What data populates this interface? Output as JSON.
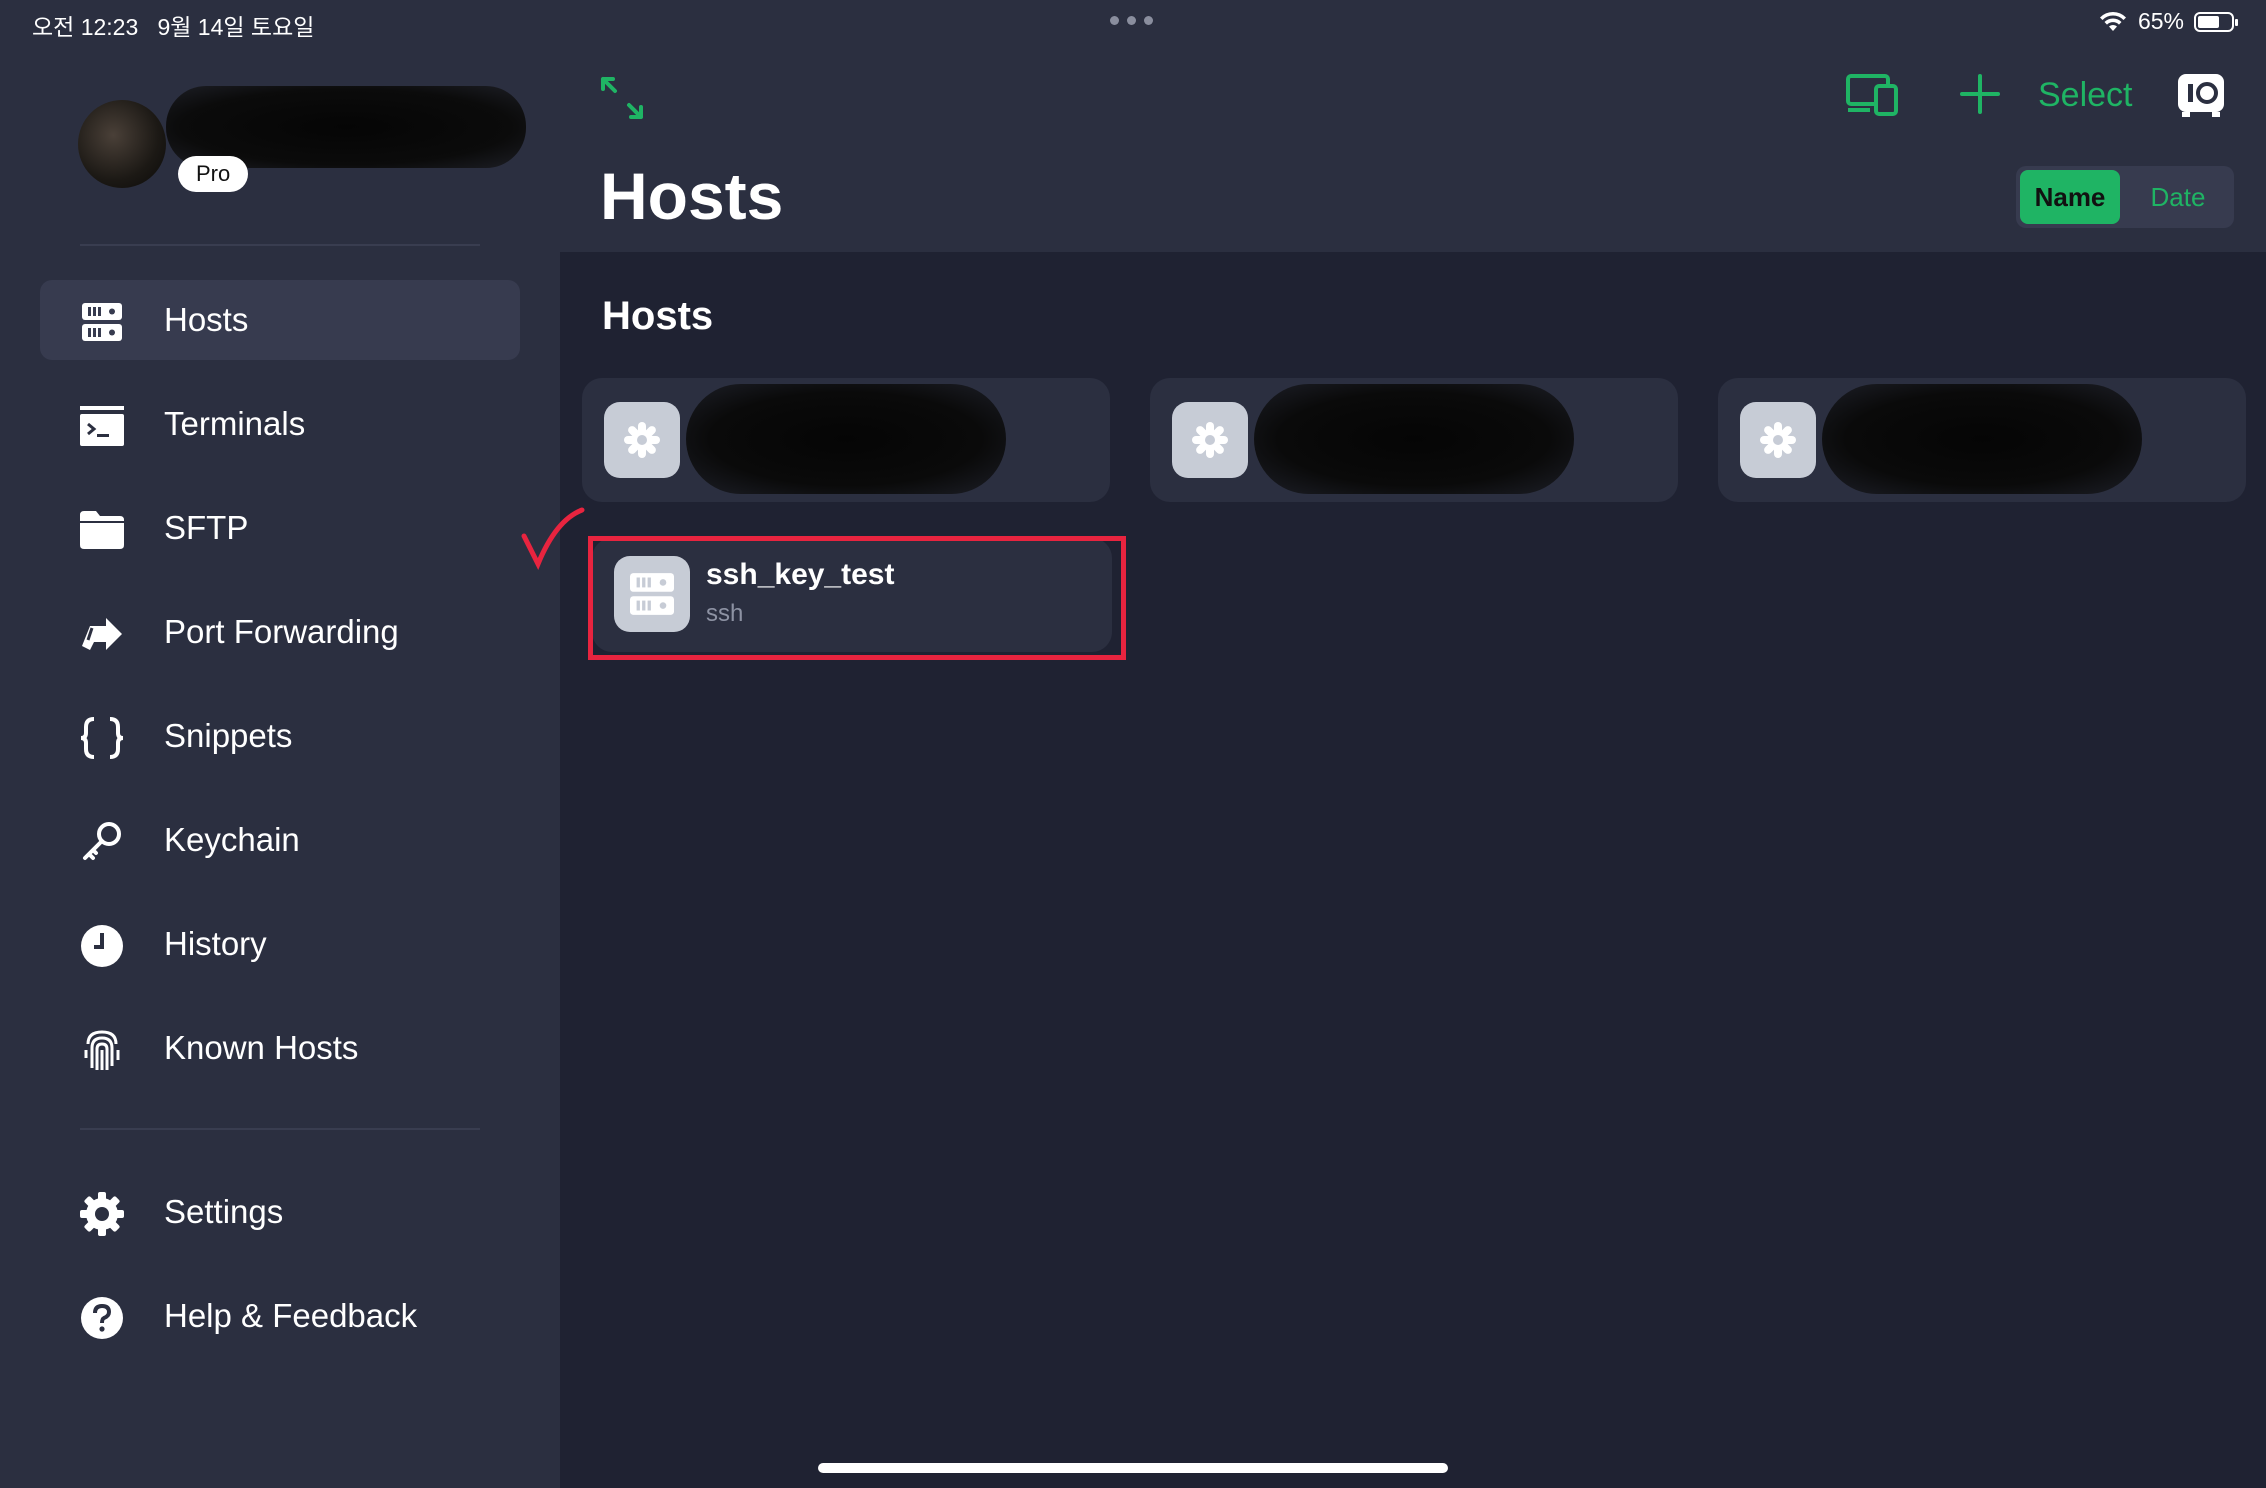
{
  "status_bar": {
    "time": "오전 12:23",
    "date": "9월 14일 토요일",
    "battery": "65%",
    "battery_level": 0.65
  },
  "profile": {
    "badge": "Pro"
  },
  "sidebar": {
    "items": [
      {
        "label": "Hosts",
        "icon": "hosts-icon",
        "active": true
      },
      {
        "label": "Terminals",
        "icon": "terminal-icon"
      },
      {
        "label": "SFTP",
        "icon": "folder-icon"
      },
      {
        "label": "Port Forwarding",
        "icon": "port-forwarding-icon"
      },
      {
        "label": "Snippets",
        "icon": "braces-icon"
      },
      {
        "label": "Keychain",
        "icon": "key-icon"
      },
      {
        "label": "History",
        "icon": "clock-icon"
      },
      {
        "label": "Known Hosts",
        "icon": "fingerprint-icon"
      }
    ],
    "footer_items": [
      {
        "label": "Settings",
        "icon": "gear-icon"
      },
      {
        "label": "Help & Feedback",
        "icon": "help-icon"
      }
    ]
  },
  "header": {
    "title": "Hosts",
    "select_label": "Select",
    "sort": {
      "options": [
        "Name",
        "Date"
      ],
      "selected": "Name"
    }
  },
  "content": {
    "section_title": "Hosts",
    "selected_host": {
      "name": "ssh_key_test",
      "type": "ssh"
    }
  },
  "colors": {
    "accent": "#1fb464",
    "highlight": "#e8243f",
    "sidebar_bg": "#2b2f40",
    "main_bg": "#1f2232"
  }
}
